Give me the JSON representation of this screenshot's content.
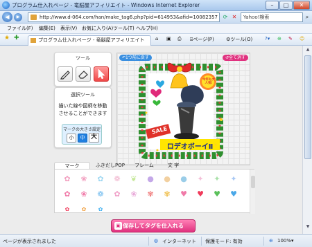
{
  "window": {
    "title": "プログラム仕入れページ - 竜脳屋アフィリエイト - Windows Internet Explorer"
  },
  "address": {
    "url": "http://www.d-064.com/han/make_tag6.php?pid=614953&afid=10082357",
    "search_placeholder": "Yahoo!検索"
  },
  "menu": {
    "items": [
      "ファイル(F)",
      "編集(E)",
      "表示(V)",
      "お気に入り(A)",
      "ツール(T)",
      "ヘルプ(H)"
    ]
  },
  "tabs": {
    "active_label": "プログラム仕入れページ - 竜脳屋アフィリエイト",
    "page_menu": "ページ(P)",
    "tools_menu": "ツール(O)"
  },
  "tool_panel": {
    "title": "ツール"
  },
  "select_panel": {
    "title": "選択ツール",
    "line1": "描いた線や図柄を移動",
    "line2": "させることができます",
    "size_title": "マークの大きさ設定",
    "sizes": [
      "小",
      "中",
      "大"
    ],
    "selected_size": "中"
  },
  "canvas": {
    "undo_label": "1つ前に戻す",
    "clear_label": "全て消す",
    "badge_text": "今年も大人気!",
    "sale_text": "SALE",
    "product_name": "ロデオボーイⅡ"
  },
  "content_tabs": [
    "マーク",
    "ふきだしPOP",
    "フレーム",
    "文 字"
  ],
  "active_content_tab": "マーク",
  "save_button": "保存してタグを仕入れる",
  "status": {
    "left": "ページが表示されました",
    "zone": "インターネット",
    "mode": "保護モード: 有効",
    "zoom": "100%"
  },
  "colors": {
    "accent_pink": "#e0327f",
    "tool_active": "#f04848",
    "size_selected": "#1e7fe0"
  }
}
